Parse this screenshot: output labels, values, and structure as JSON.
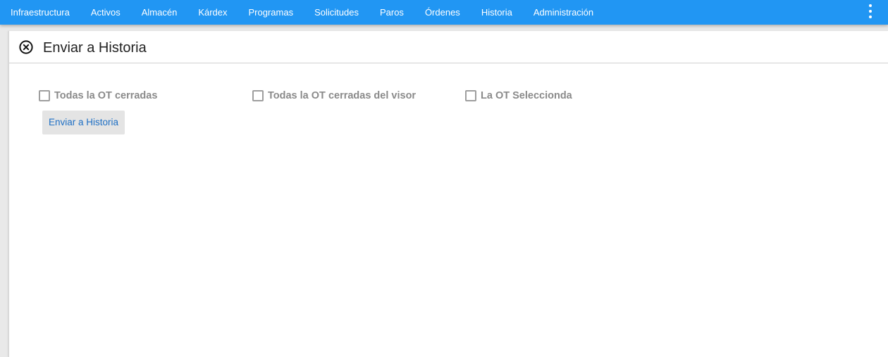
{
  "nav": {
    "items": [
      {
        "label": "Infraestructura"
      },
      {
        "label": "Activos"
      },
      {
        "label": "Almacén"
      },
      {
        "label": "Kárdex"
      },
      {
        "label": "Programas"
      },
      {
        "label": "Solicitudes"
      },
      {
        "label": "Paros"
      },
      {
        "label": "Órdenes"
      },
      {
        "label": "Historia"
      },
      {
        "label": "Administración"
      }
    ],
    "more_icon": "more-vertical-icon"
  },
  "panel": {
    "title": "Enviar a Historia",
    "close_icon": "close-circle-icon",
    "options": [
      {
        "label": "Todas la OT cerradas",
        "checked": false
      },
      {
        "label": "Todas la OT cerradas del visor",
        "checked": false
      },
      {
        "label": "La OT Seleccionda",
        "checked": false
      }
    ],
    "send_button_label": "Enviar a Historia"
  },
  "colors": {
    "topbar": "#2196f3",
    "button_text": "#1e6fc4",
    "checkbox_label": "#8a8a8a"
  }
}
